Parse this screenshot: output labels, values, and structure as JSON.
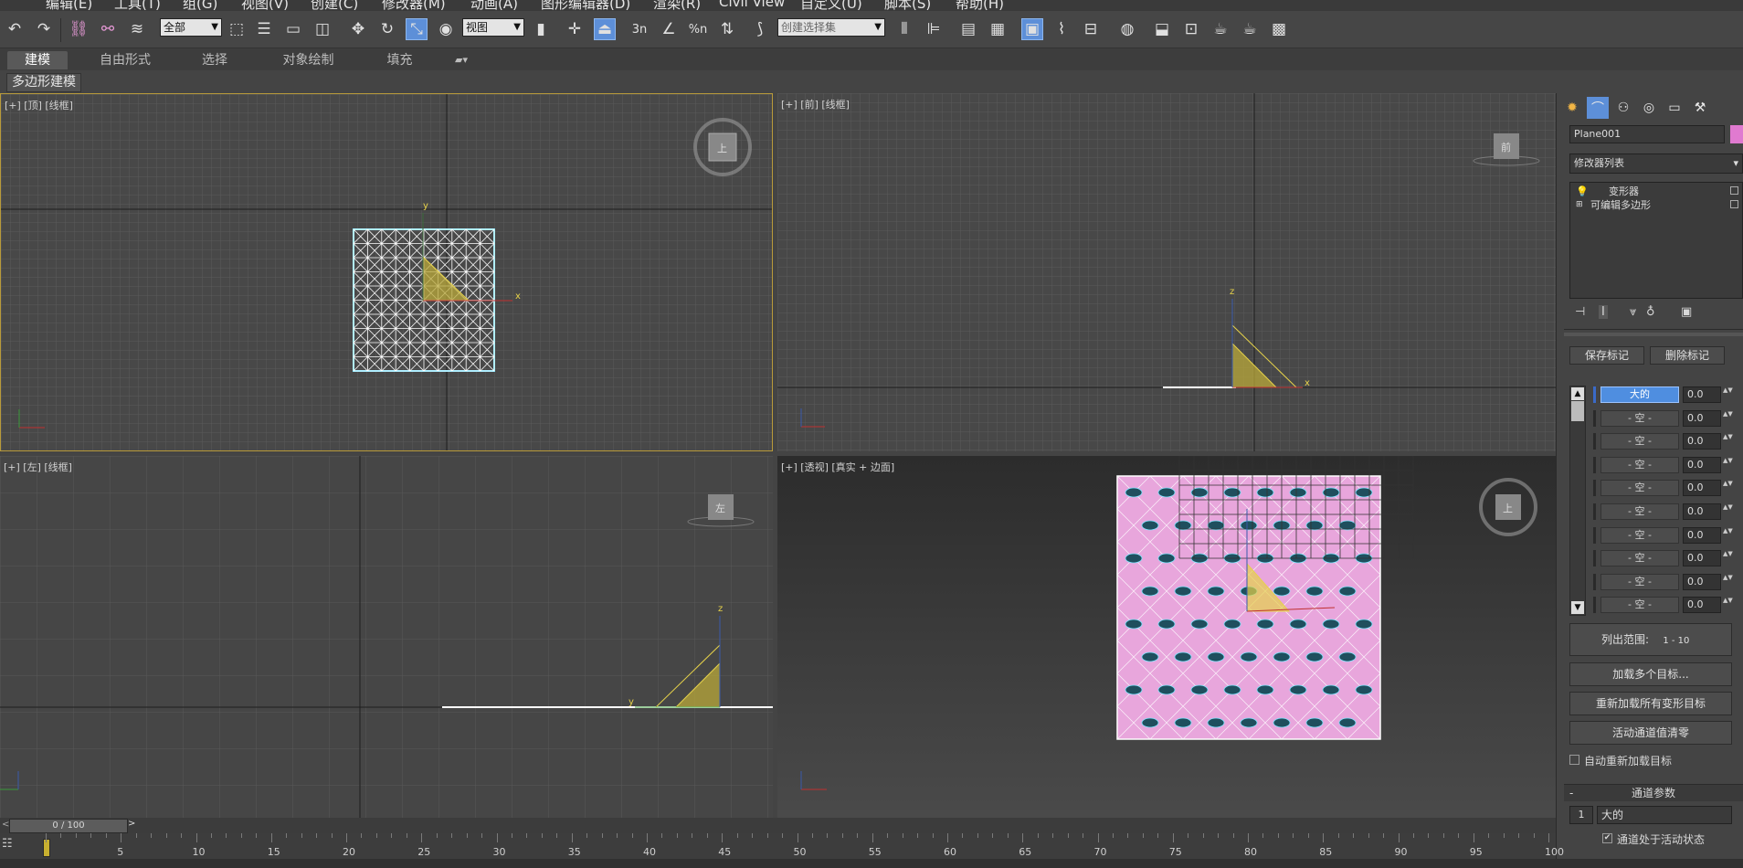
{
  "menu": [
    "编辑(E)",
    "工具(T)",
    "组(G)",
    "视图(V)",
    "创建(C)",
    "修改器(M)",
    "动画(A)",
    "图形编辑器(D)",
    "渲染(R)",
    "Civil View",
    "自定义(U)",
    "脚本(S)",
    "帮助(H)"
  ],
  "toolbar": {
    "filter_select": "全部",
    "coord_select": "视图",
    "snap_labels": [
      "3n",
      "%n"
    ],
    "selection_set_placeholder": "创建选择集"
  },
  "ribbon": {
    "tabs": [
      "建模",
      "自由形式",
      "选择",
      "对象绘制",
      "填充"
    ],
    "active_tab": "建模",
    "sub_panel": "多边形建模"
  },
  "viewports": {
    "top": {
      "label": "[+] [顶] [线框]",
      "cube": "上"
    },
    "front": {
      "label": "[+] [前] [线框]",
      "cube": "前"
    },
    "left": {
      "label": "[+] [左] [线框]",
      "cube": "左"
    },
    "perspective": {
      "label": "[+] [透视] [真实 + 边面]",
      "cube": "上"
    },
    "axes": {
      "x": "x",
      "y": "y",
      "z": "z"
    }
  },
  "command_panel": {
    "object_name": "Plane001",
    "modifier_list": "修改器列表",
    "stack": [
      "变形器",
      "可编辑多边形"
    ],
    "save_marker": "保存标记",
    "delete_marker": "删除标记",
    "channels": [
      {
        "name": "大的",
        "value": "0.0"
      },
      {
        "name": "- 空 -",
        "value": "0.0"
      },
      {
        "name": "- 空 -",
        "value": "0.0"
      },
      {
        "name": "- 空 -",
        "value": "0.0"
      },
      {
        "name": "- 空 -",
        "value": "0.0"
      },
      {
        "name": "- 空 -",
        "value": "0.0"
      },
      {
        "name": "- 空 -",
        "value": "0.0"
      },
      {
        "name": "- 空 -",
        "value": "0.0"
      },
      {
        "name": "- 空 -",
        "value": "0.0"
      },
      {
        "name": "- 空 -",
        "value": "0.0"
      }
    ],
    "list_range_label": "列出范围:",
    "list_range_value": "1 - 10",
    "load_multiple": "加载多个目标...",
    "reload_all": "重新加载所有变形目标",
    "zero_active": "活动通道值清零",
    "auto_reload": "自动重新加载目标",
    "channel_params_title": "通道参数",
    "channel_index": "1",
    "channel_name": "大的",
    "channel_active": "通道处于活动状态"
  },
  "timeline": {
    "frame_display": "0 / 100",
    "ticks": [
      "5",
      "10",
      "15",
      "20",
      "25",
      "30",
      "35",
      "40",
      "45",
      "50",
      "55",
      "60",
      "65",
      "70",
      "75",
      "80",
      "85",
      "90",
      "95",
      "100"
    ]
  },
  "colors": {
    "selection_cyan": "#7fe4ff",
    "plane_pink": "#e8a6dc",
    "gizmo_yellow": "#e6d24a",
    "active_blue": "#5d8fd8"
  }
}
